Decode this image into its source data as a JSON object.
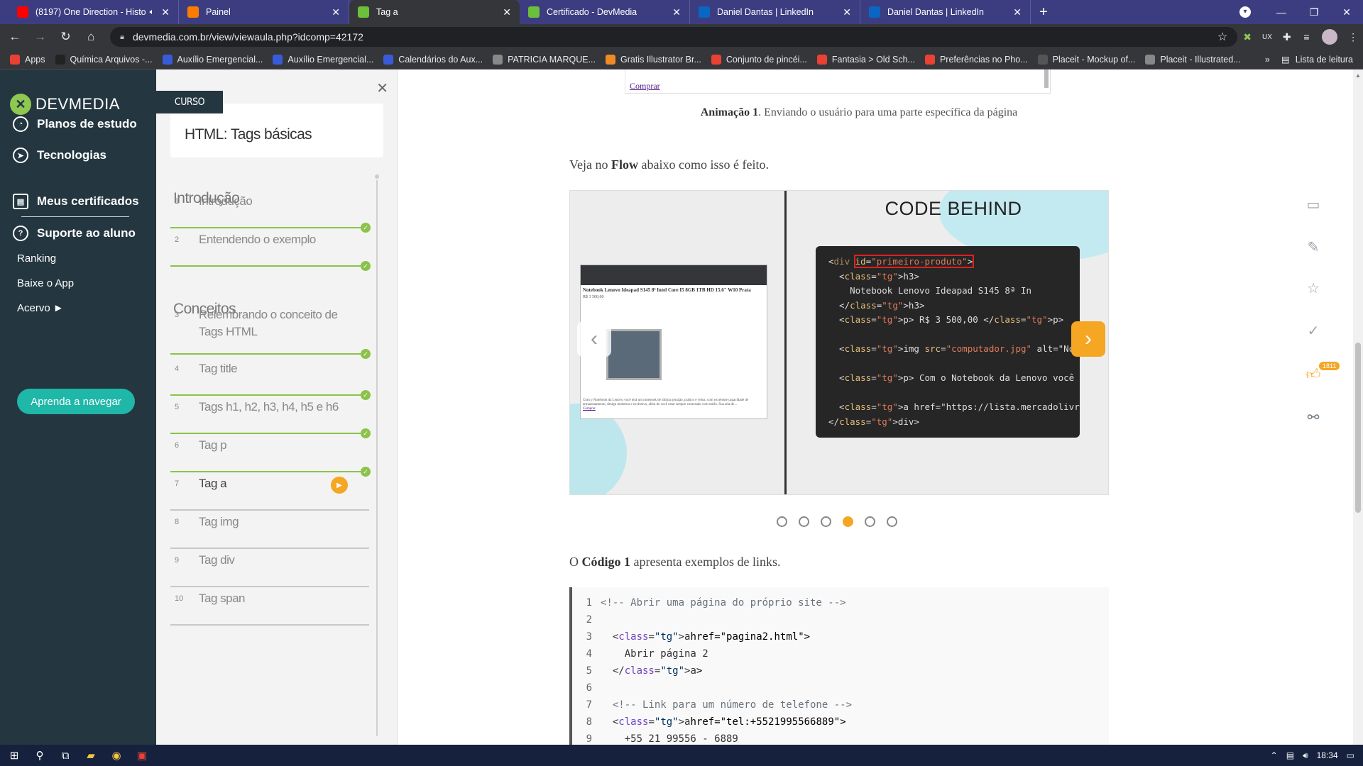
{
  "browser": {
    "tabs": [
      {
        "title": "(8197) One Direction - Histo",
        "favicon": "youtube-icon",
        "color": "#ff0000",
        "muted": true
      },
      {
        "title": "Painel",
        "favicon": "painel-icon",
        "color": "#ff7a00"
      },
      {
        "title": "Tag a",
        "favicon": "devmedia-icon",
        "color": "#6bbf3a",
        "active": true
      },
      {
        "title": "Certificado - DevMedia",
        "favicon": "devmedia-icon",
        "color": "#6bbf3a"
      },
      {
        "title": "Daniel Dantas | LinkedIn",
        "favicon": "linkedin-icon",
        "color": "#0a66c2"
      },
      {
        "title": "Daniel Dantas | LinkedIn",
        "favicon": "linkedin-icon",
        "color": "#0a66c2"
      }
    ],
    "url": "devmedia.com.br/view/viewaula.php?idcomp=42172",
    "bookmarks": [
      {
        "label": "Apps",
        "color": "#e94235"
      },
      {
        "label": "Química Arquivos -...",
        "color": "#222"
      },
      {
        "label": "Auxílio Emergencial...",
        "color": "#3a5bd9"
      },
      {
        "label": "Auxílio Emergencial...",
        "color": "#3a5bd9"
      },
      {
        "label": "Calendários do Aux...",
        "color": "#3a5bd9"
      },
      {
        "label": "PATRICIA MARQUE...",
        "color": "#888"
      },
      {
        "label": "Gratis Illustrator Br...",
        "color": "#f08a24"
      },
      {
        "label": "Conjunto de pincéi...",
        "color": "#e94235"
      },
      {
        "label": "Fantasia > Old Sch...",
        "color": "#e94235"
      },
      {
        "label": "Preferências no Pho...",
        "color": "#e94235"
      },
      {
        "label": "Placeit - Mockup of...",
        "color": "#555"
      },
      {
        "label": "Placeit - Illustrated...",
        "color": "#888"
      }
    ],
    "bookmarks_more": "»",
    "reading_list": "Lista de leitura"
  },
  "sidebar": {
    "logo_text": "DEVMEDIA",
    "items": [
      "Planos de estudo",
      "Tecnologias",
      "Meus certificados",
      "Suporte ao aluno"
    ],
    "links": [
      "Ranking",
      "Baixe o App",
      "Acervo ►"
    ],
    "cta": "Aprenda a navegar"
  },
  "course": {
    "badge": "CURSO",
    "title": "HTML: Tags básicas",
    "sections": [
      {
        "title": "Introdução"
      },
      {
        "title": "Conceitos"
      }
    ],
    "lessons": [
      {
        "num": "1",
        "title": "Introdução",
        "done": true
      },
      {
        "num": "2",
        "title": "Entendendo o exemplo",
        "done": true
      },
      {
        "num": "3",
        "title": "Relembrando o conceito de Tags HTML",
        "done": true
      },
      {
        "num": "4",
        "title": "Tag title",
        "done": true
      },
      {
        "num": "5",
        "title": "Tags h1, h2, h3, h4, h5 e h6",
        "done": true
      },
      {
        "num": "6",
        "title": "Tag p",
        "done": true
      },
      {
        "num": "7",
        "title": "Tag a",
        "done": false,
        "current": true
      },
      {
        "num": "8",
        "title": "Tag img",
        "done": false
      },
      {
        "num": "9",
        "title": "Tag div",
        "done": false
      },
      {
        "num": "10",
        "title": "Tag span",
        "done": false
      }
    ]
  },
  "content": {
    "iframe_link": "Comprar",
    "caption_bold": "Animação 1",
    "caption_rest": ". Enviando o usuário para uma parte específica da página",
    "flow_pre": "Veja no ",
    "flow_bold": "Flow",
    "flow_post": " abaixo como isso é feito.",
    "slide": {
      "code_title": "CODE BEHIND",
      "shot_title": "Notebook Lenovo Ideapad S145 8ª Intel Core I5 8GB 1TB HD 15.6\" W10 Prata",
      "shot_price": "R$ 3 500,00",
      "shot_text": "Com o Notebook da Lenovo você terá um notebook de última geração, prático e veloz, com excelente capacidade de armazenamento, design moderno e exclusivo, além de você estar sempre conectado com estilo. Sua tela de...",
      "shot_link": "Comprar",
      "code_lines": [
        "<div id=\"primeiro-produto\">",
        "  <h3>",
        "    Notebook Lenovo Ideapad S145 8ª In",
        "  </h3>",
        "  <p> R$ 3 500,00 </p>",
        "",
        "  <img src=\"computador.jpg\" alt=\"Notebo",
        "",
        "  <p> Com o Notebook da Lenovo você terá",
        "",
        "  <a href=\"https://lista.mercadolivre.co",
        "</div>"
      ],
      "dots": 6,
      "active_dot": 4
    },
    "code_intro_pre": "O ",
    "code_intro_bold": "Código 1",
    "code_intro_post": " apresenta exemplos de links.",
    "code_lines": [
      {
        "n": "1",
        "t": "<!-- Abrir uma página do próprio site -->"
      },
      {
        "n": "2",
        "t": ""
      },
      {
        "n": "3",
        "t": "  <a href=\"pagina2.html\">"
      },
      {
        "n": "4",
        "t": "    Abrir página 2"
      },
      {
        "n": "5",
        "t": "  </a>"
      },
      {
        "n": "6",
        "t": ""
      },
      {
        "n": "7",
        "t": "  <!-- Link para um número de telefone -->"
      },
      {
        "n": "8",
        "t": "  <a href=\"tel:+5521995566889\">"
      },
      {
        "n": "9",
        "t": "    +55 21 99556 - 6889"
      }
    ]
  },
  "rail": {
    "likes": "1811"
  },
  "taskbar": {
    "time": "18:34"
  }
}
